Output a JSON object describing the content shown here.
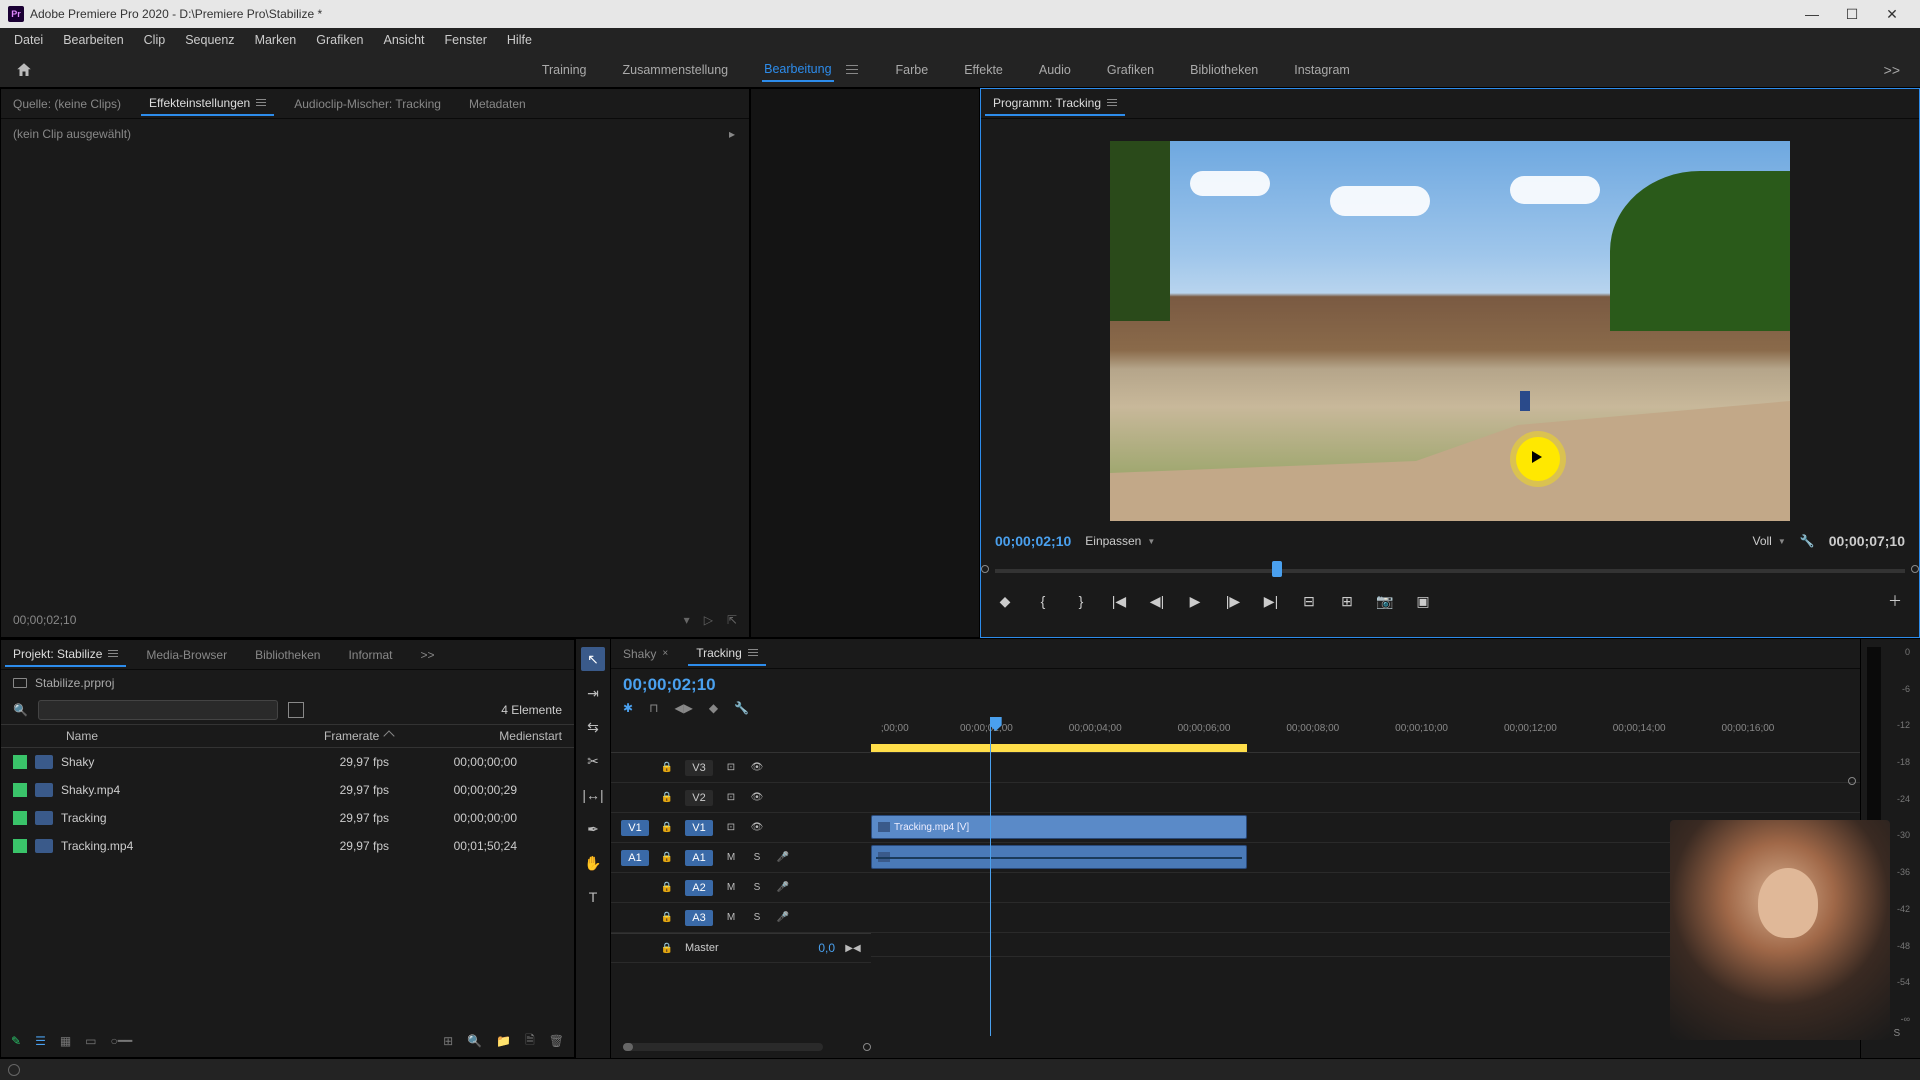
{
  "titlebar": {
    "app_initials": "Pr",
    "title": "Adobe Premiere Pro 2020 - D:\\Premiere Pro\\Stabilize *"
  },
  "menubar": [
    "Datei",
    "Bearbeiten",
    "Clip",
    "Sequenz",
    "Marken",
    "Grafiken",
    "Ansicht",
    "Fenster",
    "Hilfe"
  ],
  "workspaces": {
    "tabs": [
      "Training",
      "Zusammenstellung",
      "Bearbeitung",
      "Farbe",
      "Effekte",
      "Audio",
      "Grafiken",
      "Bibliotheken",
      "Instagram"
    ],
    "active_index": 2,
    "overflow": ">>"
  },
  "source_panel": {
    "tabs": [
      {
        "label": "Quelle: (keine Clips)",
        "active": false
      },
      {
        "label": "Effekteinstellungen",
        "active": true
      },
      {
        "label": "Audioclip-Mischer: Tracking",
        "active": false
      },
      {
        "label": "Metadaten",
        "active": false
      }
    ],
    "no_clip_text": "(kein Clip ausgewählt)",
    "footer_tc": "00;00;02;10"
  },
  "program_panel": {
    "tab_label": "Programm: Tracking",
    "current_tc": "00;00;02;10",
    "zoom_label": "Einpassen",
    "quality_label": "Voll",
    "duration_tc": "00;00;07;10"
  },
  "project_panel": {
    "tabs": [
      {
        "label": "Projekt: Stabilize",
        "active": true
      },
      {
        "label": "Media-Browser",
        "active": false
      },
      {
        "label": "Bibliotheken",
        "active": false
      },
      {
        "label": "Informat",
        "active": false
      }
    ],
    "overflow": ">>",
    "project_file": "Stabilize.prproj",
    "search_placeholder": "",
    "item_count": "4 Elemente",
    "columns": {
      "name": "Name",
      "framerate": "Framerate",
      "mediastart": "Medienstart"
    },
    "items": [
      {
        "name": "Shaky",
        "framerate": "29,97 fps",
        "mediastart": "00;00;00;00"
      },
      {
        "name": "Shaky.mp4",
        "framerate": "29,97 fps",
        "mediastart": "00;00;00;29"
      },
      {
        "name": "Tracking",
        "framerate": "29,97 fps",
        "mediastart": "00;00;00;00"
      },
      {
        "name": "Tracking.mp4",
        "framerate": "29,97 fps",
        "mediastart": "00;01;50;24"
      }
    ]
  },
  "timeline": {
    "tabs": [
      {
        "label": "Shaky",
        "active": false
      },
      {
        "label": "Tracking",
        "active": true
      }
    ],
    "current_tc": "00;00;02;10",
    "ruler_ticks": [
      ";00;00",
      "00;00;02;00",
      "00;00;04;00",
      "00;00;06;00",
      "00;00;08;00",
      "00;00;10;00",
      "00;00;12;00",
      "00;00;14;00",
      "00;00;16;00"
    ],
    "video_tracks": [
      "V3",
      "V2",
      "V1"
    ],
    "source_v": "V1",
    "audio_tracks": [
      "A1",
      "A2",
      "A3"
    ],
    "source_a": "A1",
    "master_label": "Master",
    "master_val": "0,0",
    "clip_name": "Tracking.mp4 [V]",
    "playhead_pct": 12,
    "clip_start_pct": 0,
    "clip_end_pct": 38
  },
  "audio_meter": {
    "scale": [
      "0",
      "-6",
      "-12",
      "-18",
      "-24",
      "-30",
      "-36",
      "-42",
      "-48",
      "-54",
      "-∞"
    ],
    "solo_label": "S",
    "solo_label2": "S"
  }
}
